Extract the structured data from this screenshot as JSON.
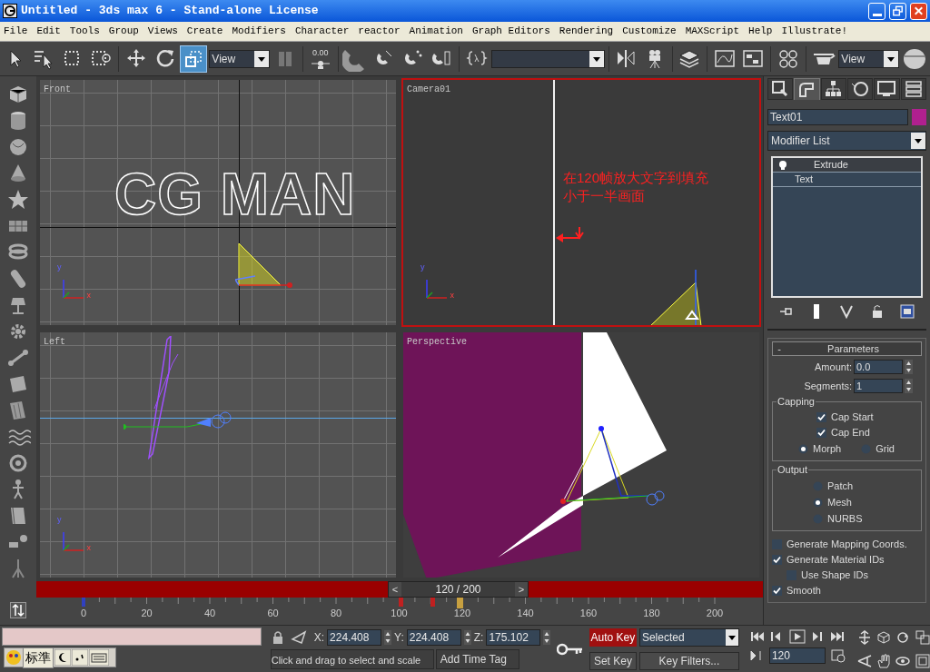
{
  "window": {
    "title": "Untitled - 3ds max 6 - Stand-alone License"
  },
  "menu": [
    "File",
    "Edit",
    "Tools",
    "Group",
    "Views",
    "Create",
    "Modifiers",
    "Character",
    "reactor",
    "Animation",
    "Graph Editors",
    "Rendering",
    "Customize",
    "MAXScript",
    "Help",
    "Illustrate!"
  ],
  "toolbar": [
    {
      "kind": "tool",
      "selected": false
    },
    {
      "kind": "tool",
      "selected": false
    },
    {
      "kind": "tool",
      "selected": false
    },
    {
      "kind": "tool",
      "selected": false
    },
    {
      "kind": "sep"
    },
    {
      "kind": "tool",
      "selected": false
    },
    {
      "kind": "tool",
      "selected": false
    },
    {
      "kind": "tool",
      "selected": true
    },
    {
      "kind": "dropdown",
      "value": "View"
    },
    {
      "kind": "tool",
      "selected": false
    },
    {
      "kind": "sep"
    },
    {
      "kind": "spinner",
      "text": "0.00"
    },
    {
      "kind": "sep"
    },
    {
      "kind": "tool",
      "selected": false
    },
    {
      "kind": "tool",
      "selected": false
    },
    {
      "kind": "tool",
      "selected": false
    },
    {
      "kind": "tool",
      "selected": false
    },
    {
      "kind": "sep"
    },
    {
      "kind": "tool",
      "selected": false
    },
    {
      "kind": "field"
    },
    {
      "kind": "sep"
    },
    {
      "kind": "tool",
      "selected": false
    },
    {
      "kind": "tool",
      "selected": false
    },
    {
      "kind": "sep"
    },
    {
      "kind": "tool",
      "selected": false
    },
    {
      "kind": "sep"
    },
    {
      "kind": "tool",
      "selected": false
    },
    {
      "kind": "tool",
      "selected": false
    },
    {
      "kind": "sep"
    },
    {
      "kind": "tool",
      "selected": false
    },
    {
      "kind": "sep"
    },
    {
      "kind": "tool",
      "selected": false
    },
    {
      "kind": "dropdown",
      "value": "View"
    },
    {
      "kind": "tool",
      "selected": false
    }
  ],
  "viewports": [
    {
      "label": "Front",
      "kind": "front",
      "selected": false,
      "scene_text": "CG MAN",
      "axis_labels": [
        "y",
        "x"
      ]
    },
    {
      "label": "Camera01",
      "kind": "camera",
      "selected": true,
      "annotation": [
        "在120帧放大文字到填充",
        "小于一半画面"
      ],
      "axis_labels": [
        "y",
        "x"
      ]
    },
    {
      "label": "Left",
      "kind": "left",
      "selected": false,
      "axis_labels": [
        "y",
        "x"
      ]
    },
    {
      "label": "Perspective",
      "kind": "perspective",
      "selected": false
    }
  ],
  "command_panel": {
    "tabs": [
      {
        "selected": false
      },
      {
        "selected": true
      },
      {
        "selected": false
      },
      {
        "selected": false
      },
      {
        "selected": false
      },
      {
        "selected": false
      }
    ],
    "object_name": "Text01",
    "color": "#b0208f",
    "modifier_list": "Modifier List",
    "stack": [
      {
        "label": "Extrude",
        "selected": true
      },
      {
        "label": "Text",
        "selected": false
      }
    ],
    "parameters": {
      "title": "Parameters",
      "collapse": "-",
      "spinners": [
        {
          "label": "Amount:",
          "value": "0.0"
        },
        {
          "label": "Segments:",
          "value": "1"
        }
      ],
      "capping": {
        "title": "Capping",
        "checks": [
          {
            "label": "Cap Start",
            "checked": true
          },
          {
            "label": "Cap End",
            "checked": true
          }
        ],
        "radios": [
          {
            "label": "Morph",
            "selected": true
          },
          {
            "label": "Grid",
            "selected": false
          }
        ]
      },
      "output": {
        "title": "Output",
        "radios": [
          {
            "label": "Patch",
            "selected": false
          },
          {
            "label": "Mesh",
            "selected": true
          },
          {
            "label": "NURBS",
            "selected": false
          }
        ]
      },
      "options": [
        {
          "label": "Generate Mapping Coords.",
          "checked": false,
          "indent": false
        },
        {
          "label": "Generate Material IDs",
          "checked": true,
          "indent": false
        },
        {
          "label": "Use Shape IDs",
          "checked": false,
          "indent": true
        },
        {
          "label": "Smooth",
          "checked": true,
          "indent": false
        }
      ]
    }
  },
  "timeline": {
    "frame_label": "120 / 200",
    "level": 0.6,
    "prev": "<",
    "next": ">",
    "ticks": [
      "0",
      "20",
      "40",
      "60",
      "80",
      "100",
      "120",
      "140",
      "160",
      "180",
      "200"
    ]
  },
  "status": {
    "coords": [
      {
        "axis": "X:",
        "value": "224.408"
      },
      {
        "axis": "Y:",
        "value": "224.408"
      },
      {
        "axis": "Z:",
        "value": "175.102"
      }
    ],
    "prompt": "Click and drag to select and scale",
    "time_tag": "Add Time Tag",
    "auto_key": {
      "label": "Auto Key",
      "on": true
    },
    "key_mode": "Selected",
    "set_key": "Set Key",
    "key_filters": "Key Filters...",
    "frame": "120",
    "ime": "标準"
  }
}
